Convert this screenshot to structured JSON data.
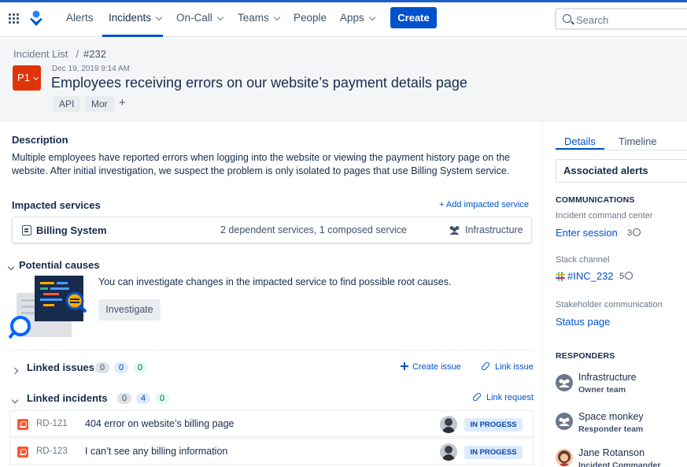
{
  "nav": {
    "items": [
      {
        "label": "Alerts"
      },
      {
        "label": "Incidents"
      },
      {
        "label": "On-Call"
      },
      {
        "label": "Teams"
      },
      {
        "label": "People"
      },
      {
        "label": "Apps"
      }
    ],
    "create_label": "Create",
    "search_placeholder": "Search"
  },
  "header": {
    "breadcrumb_root": "Incident List",
    "breadcrumb_sep": "/",
    "incident_id": "#232",
    "priority": "P1",
    "date": "Dec 19, 2019 9:14 AM",
    "title": "Employees receiving errors on our website’s payment details page",
    "tags": [
      "API",
      "Mor"
    ],
    "add_tag": "+"
  },
  "description": {
    "heading": "Description",
    "text": "Multiple employees have reported errors when logging into the website or viewing the payment history page on the website. After initial investigation, we suspect the problem is only isolated to pages that use Billing System service."
  },
  "impacted": {
    "heading": "Impacted services",
    "add_link": "+ Add impacted service",
    "service_name": "Billing System",
    "dependencies": "2 dependent services,   1 composed service",
    "team": "Infrastructure"
  },
  "causes": {
    "heading": "Potential causes",
    "text": "You can investigate changes in the impacted service to find possible root causes.",
    "button": "Investigate"
  },
  "linked_issues": {
    "heading": "Linked issues",
    "counts": [
      "0",
      "0",
      "0"
    ],
    "create_link": "Create issue",
    "link_link": "Link issue"
  },
  "linked_incidents": {
    "heading": "Linked incidents",
    "counts": [
      "0",
      "4",
      "0"
    ],
    "link_request": "Link request",
    "rows": [
      {
        "key": "RD-121",
        "summary": "404 error on website’s billing page",
        "status": "IN PROGESS"
      },
      {
        "key": "RD-123",
        "summary": "I can’t see any billing information",
        "status": "IN PROGESS"
      }
    ]
  },
  "panel": {
    "tabs": [
      "Details",
      "Timeline"
    ],
    "associated_alerts": "Associated alerts",
    "communications_heading": "COMMUNICATIONS",
    "icc_label": "Incident command center",
    "icc_link": "Enter session",
    "icc_count": "3",
    "slack_label": "Slack channel",
    "slack_link": "#INC_232",
    "slack_count": "5",
    "stakeholder_label": "Stakeholder communication",
    "stakeholder_link": "Status page",
    "responders_heading": "RESPONDERS",
    "responders": [
      {
        "name": "Infrastructure",
        "role": "Owner team"
      },
      {
        "name": "Space monkey",
        "role": "Responder team"
      },
      {
        "name": "Jane Rotanson",
        "role": "Incident Commander"
      }
    ]
  },
  "colors": {
    "brand_blue": "#0052cc",
    "priority_red": "#de350b",
    "status_blue_bg": "#deebff"
  }
}
